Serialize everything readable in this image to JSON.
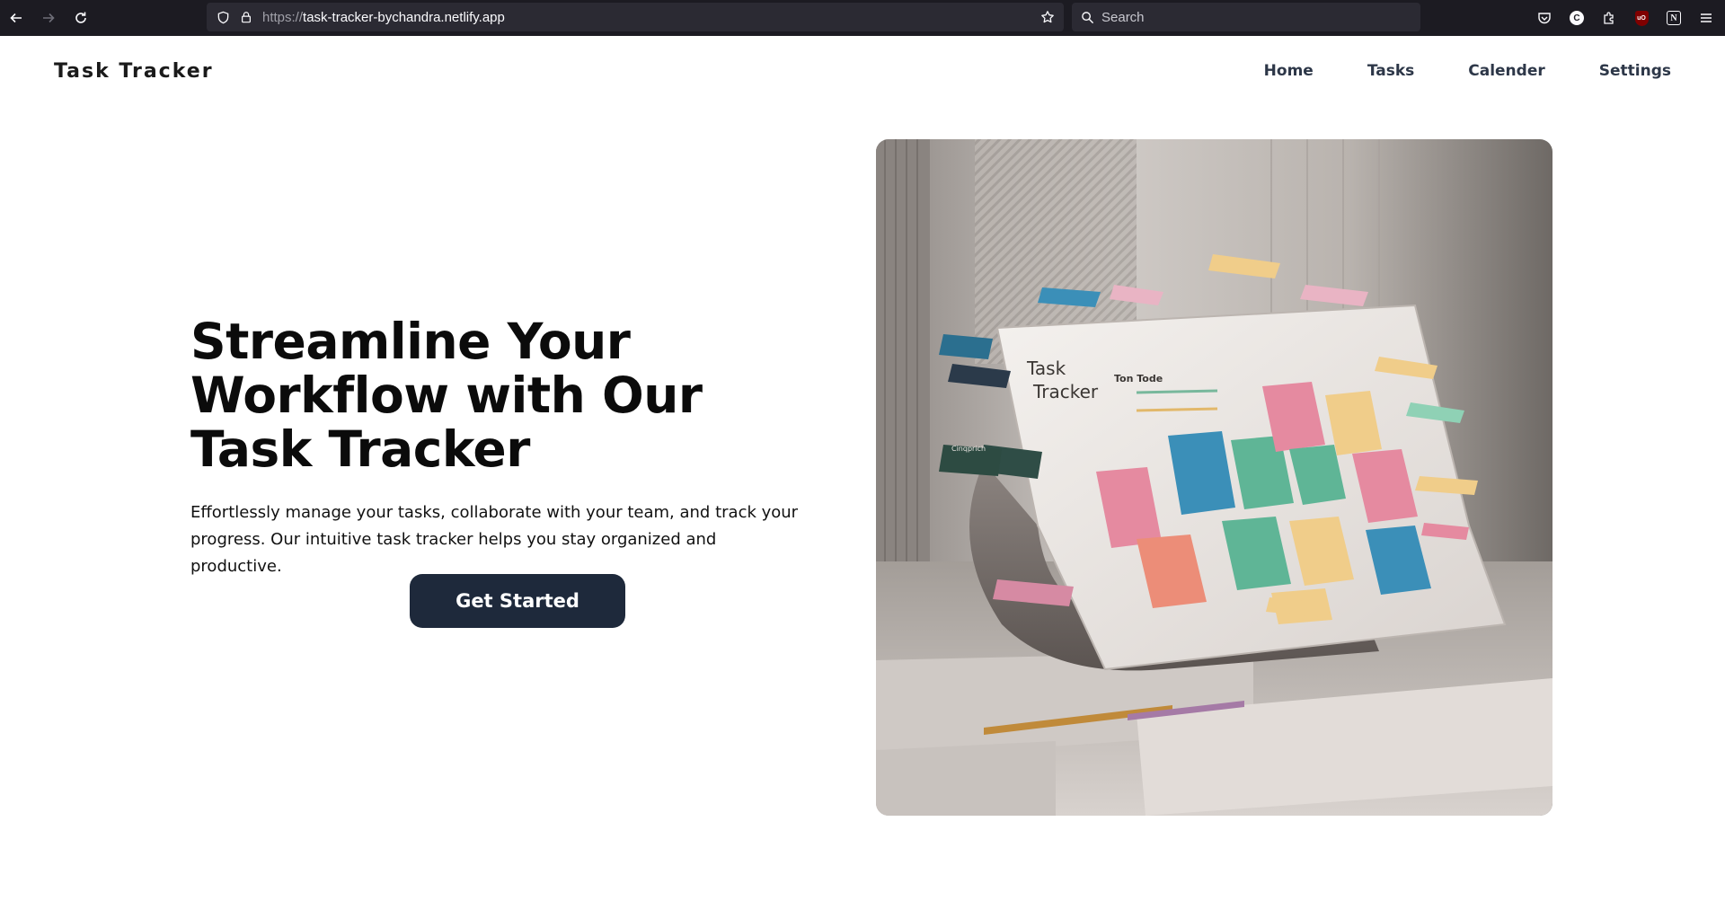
{
  "browser": {
    "url_prefix": "https://",
    "url_host": "task-tracker-bychandra.netlify.app",
    "search_placeholder": "Search"
  },
  "site": {
    "brand": "Task Tracker",
    "nav": [
      "Home",
      "Tasks",
      "Calender",
      "Settings"
    ]
  },
  "hero": {
    "title": "Streamline Your Workflow with Our Task Tracker",
    "description": "Effortlessly manage your tasks, collaborate with your team, and track your progress. Our intuitive task tracker helps you stay organized and productive.",
    "cta_label": "Get Started",
    "image_text": {
      "app_title_line1": "Task",
      "app_title_line2": "Tracker",
      "todo_heading": "Ton Tode",
      "badge_label": "Cinqprich"
    }
  },
  "colors": {
    "button_bg": "#1e293b",
    "nav_text": "#2d3748",
    "card_pink": "#e58aa0",
    "card_blue": "#3b8fb8",
    "card_green": "#5fb596",
    "card_yellow": "#f0cd8a",
    "card_salmon": "#ec8d78"
  }
}
